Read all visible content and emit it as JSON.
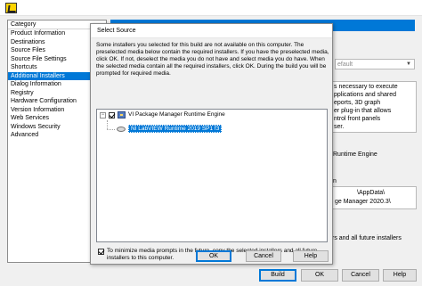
{
  "categories": {
    "header": "Category",
    "items": [
      "Product Information",
      "Destinations",
      "Source Files",
      "Source File Settings",
      "Shortcuts",
      "Additional Installers",
      "Dialog Information",
      "Registry",
      "Hardware Configuration",
      "Version Information",
      "Web Services",
      "Windows Security",
      "Advanced"
    ],
    "selected_index": 5
  },
  "background": {
    "combo_value": "efault",
    "desc_lines": [
      "s necessary to execute",
      "pplications and shared",
      "eports, 3D graph",
      "er plug-in that allows",
      "ntrol front panels",
      "ser."
    ],
    "runtime_engine_label": "Runtime Engine",
    "n_label": "n",
    "path_line1": "\\AppData\\",
    "path_line2": "ge Manager 2020.3\\",
    "bottom_text": "rs and all future installers",
    "buttons": {
      "build": "Build",
      "ok": "OK",
      "cancel": "Cancel",
      "help": "Help"
    }
  },
  "dialog": {
    "title": "Select Source",
    "message": "Some installers you selected for this build are not available on this computer. The preselected media below contain the required installers. If you have the preselected media, click OK. If not, deselect the media you do not have and select media you do have. When the selected media contain all the required installers, click OK. During the build you will be prompted for required media.",
    "tree": {
      "parent_label": "VI Package Manager Runtime Engine",
      "child_label": "NI LabVIEW Runtime 2019 SP1 f3"
    },
    "minimize_label": "To minimize media prompts in the future, copy the selected installers and all future installers to this computer.",
    "buttons": {
      "ok": "OK",
      "cancel": "Cancel",
      "help": "Help"
    }
  }
}
